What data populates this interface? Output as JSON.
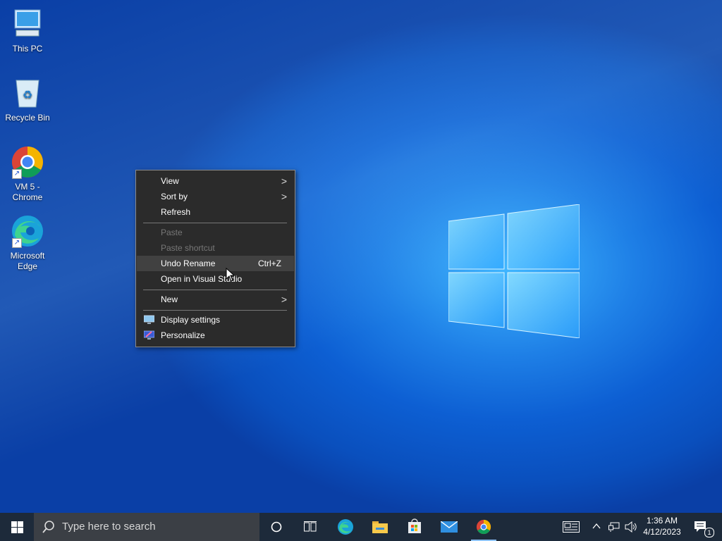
{
  "desktop": {
    "icons": [
      {
        "label": "This PC",
        "icon": "computer-icon"
      },
      {
        "label": "Recycle Bin",
        "icon": "recycle-bin-icon"
      },
      {
        "label": "VM 5 - Chrome",
        "icon": "chrome-icon"
      },
      {
        "label": "Microsoft Edge",
        "icon": "edge-icon"
      }
    ]
  },
  "context_menu": {
    "items": [
      {
        "label": "View",
        "submenu": true
      },
      {
        "label": "Sort by",
        "submenu": true
      },
      {
        "label": "Refresh"
      },
      {
        "label": "Paste",
        "disabled": true
      },
      {
        "label": "Paste shortcut",
        "disabled": true
      },
      {
        "label": "Undo Rename",
        "shortcut": "Ctrl+Z",
        "highlighted": true
      },
      {
        "label": "Open in Visual Studio"
      },
      {
        "label": "New",
        "submenu": true
      },
      {
        "label": "Display settings",
        "icon": "display-icon"
      },
      {
        "label": "Personalize",
        "icon": "personalize-icon"
      }
    ],
    "submenu_arrow": ">"
  },
  "taskbar": {
    "search_placeholder": "Type here to search",
    "apps": [
      "cortana-icon",
      "task-view-icon",
      "edge-icon",
      "file-explorer-icon",
      "store-icon",
      "mail-icon",
      "chrome-icon"
    ],
    "clock": {
      "time": "1:36 AM",
      "date": "4/12/2023"
    },
    "notification_count": "1"
  },
  "colors": {
    "taskbar_bg": "#1d2a3a",
    "menu_bg": "#2b2b2b",
    "menu_highlight": "#414141",
    "desktop_accent": "#0d5fd3"
  }
}
